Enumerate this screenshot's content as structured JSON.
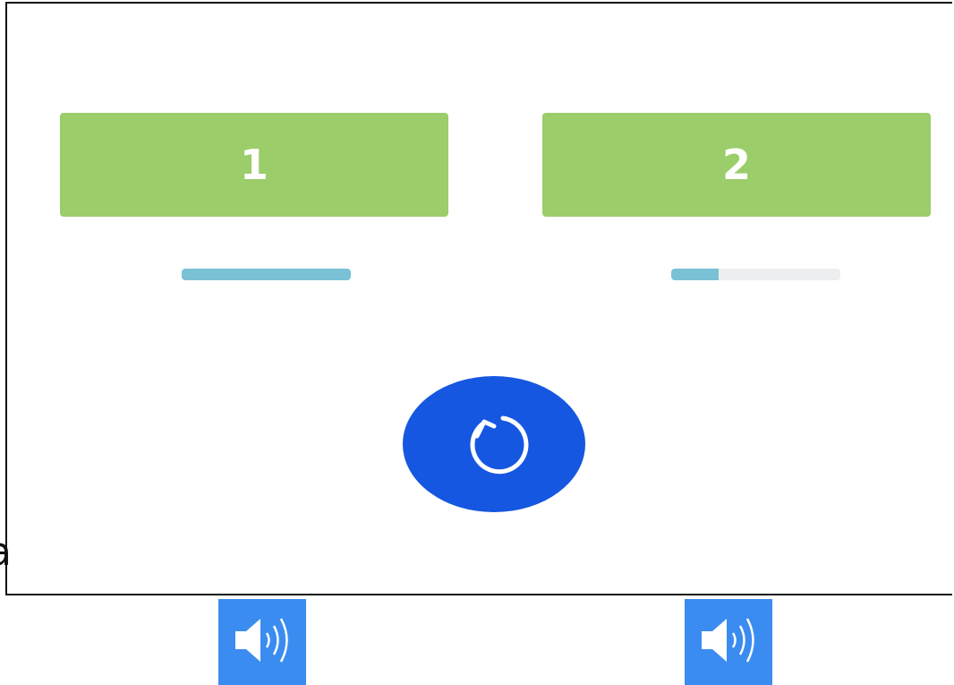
{
  "choices": [
    {
      "label": "1",
      "progress": 1.0
    },
    {
      "label": "2",
      "progress": 0.28
    }
  ],
  "stray_text": "a",
  "replay": {
    "icon": "replay-icon"
  },
  "sound_buttons": [
    {
      "icon": "speaker-icon"
    },
    {
      "icon": "speaker-icon"
    }
  ],
  "colors": {
    "choice_bg": "#9bcd6a",
    "bar_fill": "#7ac1d6",
    "bar_track": "#eceeef",
    "replay_bg": "#1557e0",
    "sound_bg": "#3b8cf0",
    "frame_border": "#111111"
  }
}
